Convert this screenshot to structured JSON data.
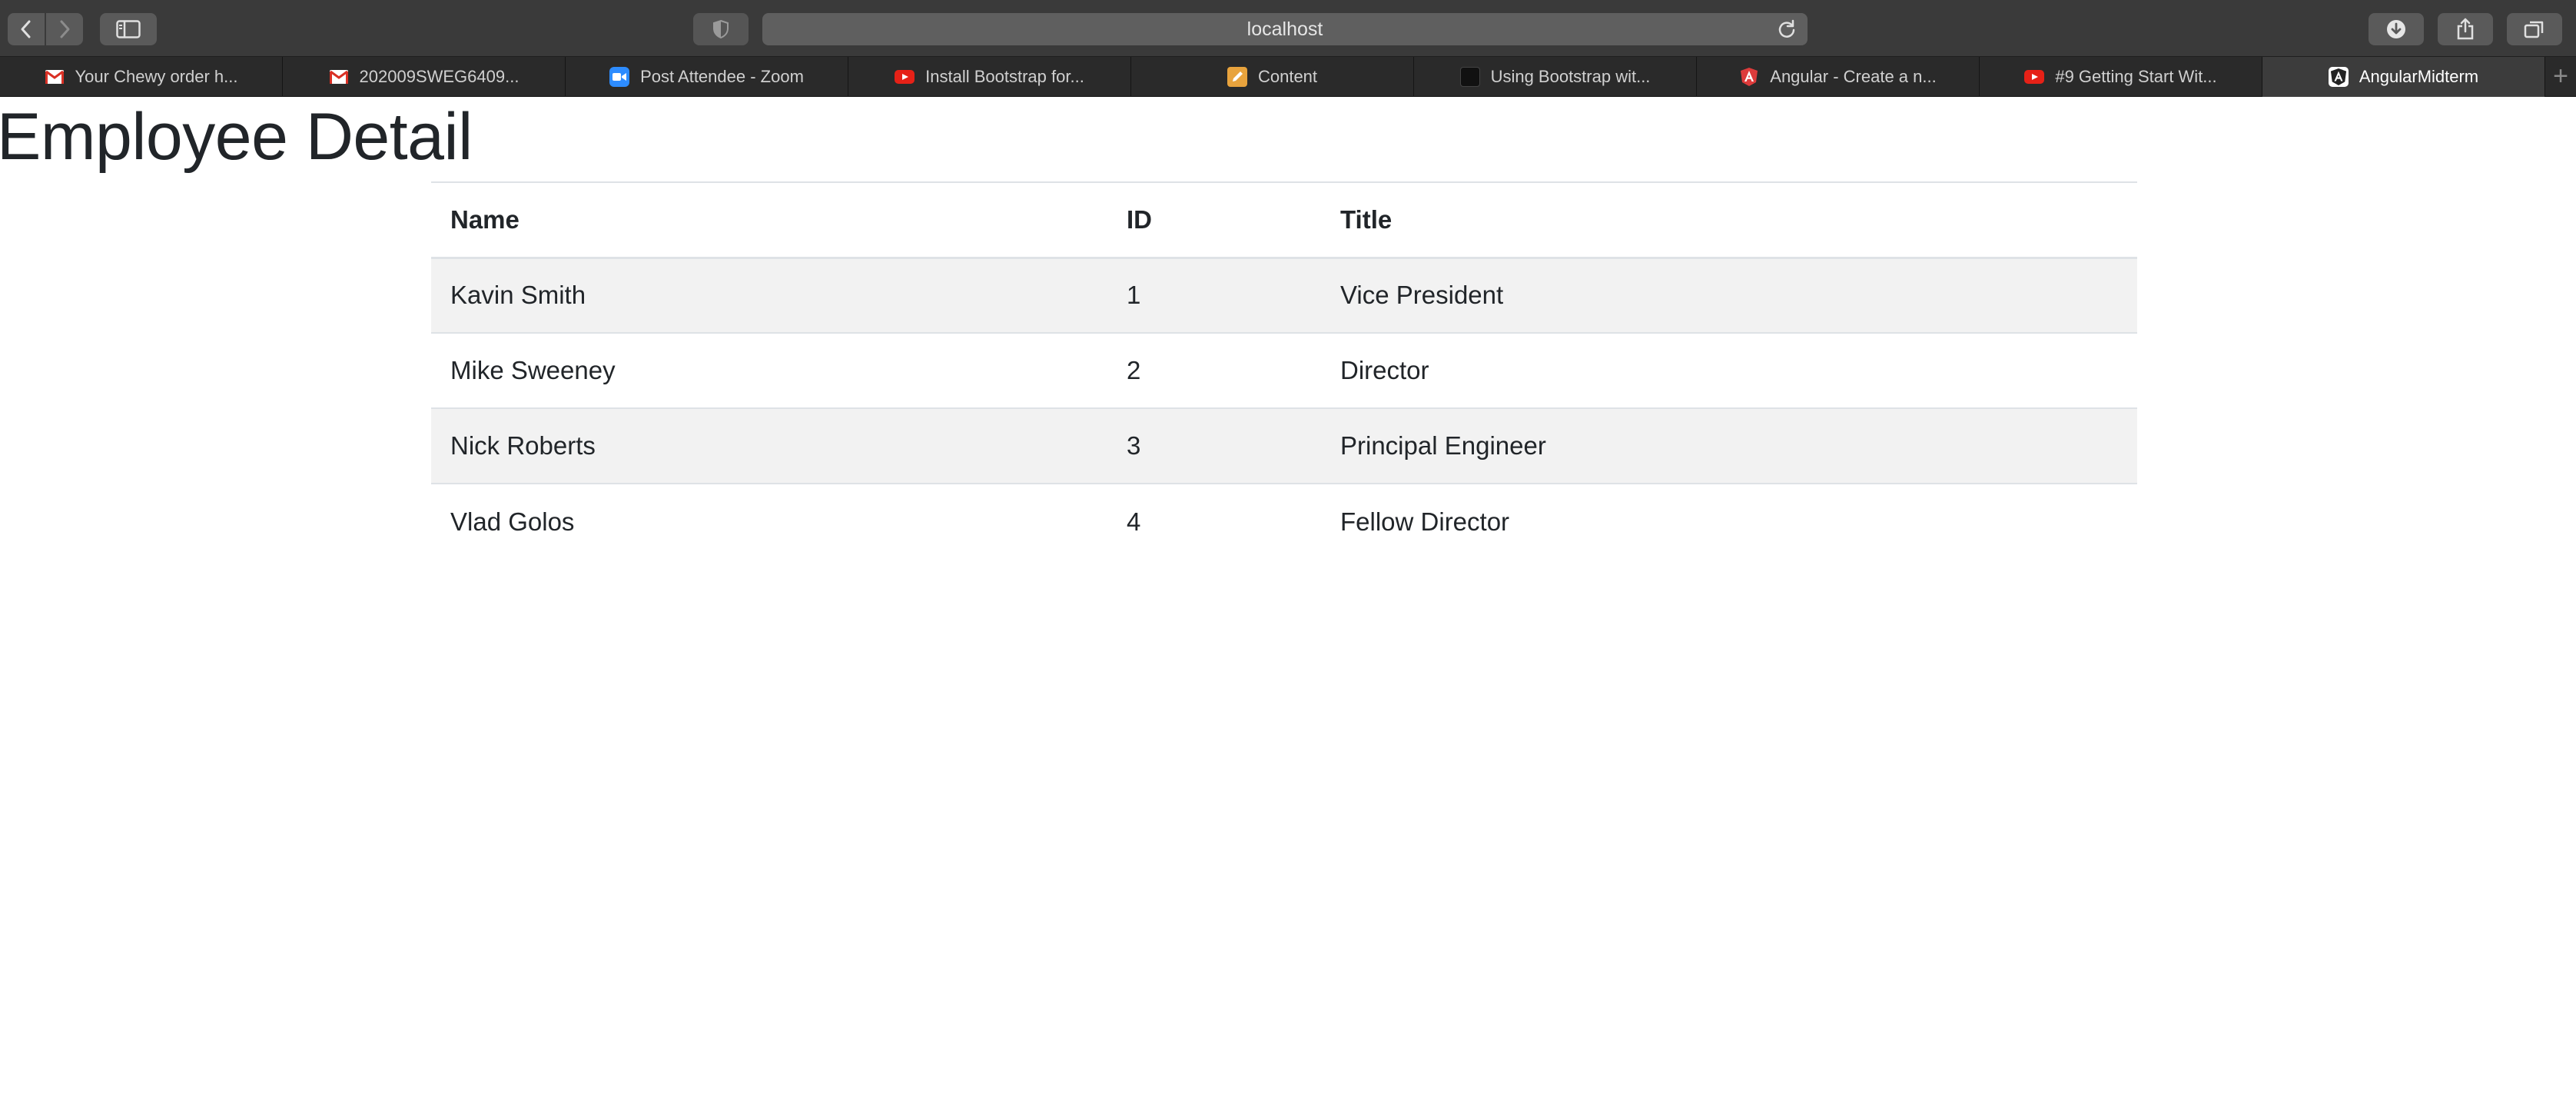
{
  "browser": {
    "address": "localhost",
    "tabs": [
      {
        "label": "Your Chewy order h...",
        "icon": "gmail-icon"
      },
      {
        "label": "202009SWEG6409...",
        "icon": "gmail-icon"
      },
      {
        "label": "Post Attendee - Zoom",
        "icon": "zoom-icon"
      },
      {
        "label": "Install Bootstrap for...",
        "icon": "youtube-icon"
      },
      {
        "label": "Content",
        "icon": "pencil-icon"
      },
      {
        "label": "Using Bootstrap wit...",
        "icon": "dark-square-icon"
      },
      {
        "label": "Angular - Create a n...",
        "icon": "angular-icon"
      },
      {
        "label": "#9 Getting Start Wit...",
        "icon": "youtube-icon"
      },
      {
        "label": "AngularMidterm",
        "icon": "angular-icon",
        "active": true
      }
    ],
    "new_tab": "+"
  },
  "page": {
    "title": "Employee Detail",
    "table": {
      "headers": [
        "Name",
        "ID",
        "Title"
      ],
      "rows": [
        [
          "Kavin Smith",
          "1",
          "Vice President"
        ],
        [
          "Mike Sweeney",
          "2",
          "Director"
        ],
        [
          "Nick Roberts",
          "3",
          "Principal Engineer"
        ],
        [
          "Vlad Golos",
          "4",
          "Fellow Director"
        ]
      ]
    }
  },
  "colors": {
    "toolbar": "#3a3a3a",
    "tabstrip": "#2a2a2a",
    "text": "#212529",
    "row_stripe": "#f2f2f2",
    "table_border": "#dee2e6",
    "youtube_red": "#e62117",
    "zoom_blue": "#2d8cff",
    "angular_red": "#dd3b3b"
  }
}
